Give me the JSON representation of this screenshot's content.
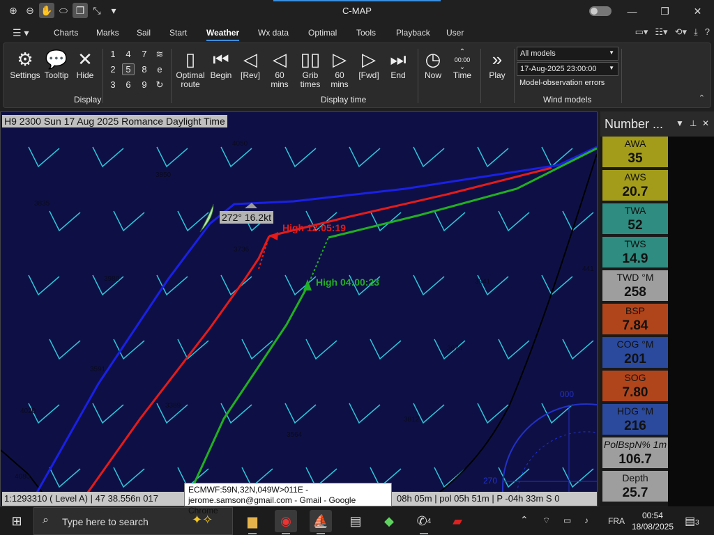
{
  "window": {
    "title": "C-MAP"
  },
  "menu": {
    "items": [
      "Charts",
      "Marks",
      "Sail",
      "Start",
      "Weather",
      "Wx data",
      "Optimal",
      "Tools",
      "Playback",
      "User"
    ],
    "active": "Weather"
  },
  "ribbon": {
    "display": {
      "settings": "Settings",
      "tooltip": "Tooltip",
      "hide": "Hide",
      "group": "Display",
      "numbers": [
        "1",
        "4",
        "7",
        "2",
        "5",
        "8",
        "3",
        "6",
        "9"
      ],
      "extra_e": "e"
    },
    "display_time": {
      "group": "Display time",
      "optimal_route": "Optimal route",
      "begin": "Begin",
      "rev": "[Rev]",
      "back60": "60 mins",
      "grib_times": "Grib times",
      "fwd60": "60 mins",
      "fwd": "[Fwd]",
      "end": "End",
      "now": "Now",
      "time": "Time",
      "time_clock": "00:00",
      "play": "Play"
    },
    "wind_models": {
      "group": "Wind models",
      "model": "All models",
      "datetime": "17-Aug-2025 23:00:00",
      "errors": "Model-observation errors"
    }
  },
  "map": {
    "header": "H9 2300 Sun 17 Aug 2025 Romance Daylight Time",
    "boat_label": "272° 16.2kt",
    "high_red": "High 12:05:19",
    "high_green": "High 04:00:23",
    "depths": [
      "4050",
      "3850",
      "3835",
      "3736",
      "3980",
      "3941",
      "3674",
      "3389",
      "3820",
      "4020",
      "3812",
      "3564",
      "4080",
      "441",
      "3591"
    ],
    "compass": [
      "000",
      "270"
    ],
    "status": "1:1293310 ( Level A) | 47 38.556n 017",
    "status_right": "08h 05m | pol 05h 51m | P -04h 33m S 0",
    "tooltip_line1": "ECMWF:59N,32N,049W>011E -",
    "tooltip_line2": "jerome.samson@gmail.com - Gmail - Google Chrome"
  },
  "panel": {
    "title": "Number ...",
    "cells": [
      {
        "label": "AWA",
        "value": "35",
        "color": "#a39c1a"
      },
      {
        "label": "AWS",
        "value": "20.7",
        "color": "#a39c1a"
      },
      {
        "label": "TWA",
        "value": "52",
        "color": "#2e8c80"
      },
      {
        "label": "TWS",
        "value": "14.9",
        "color": "#2e8c80"
      },
      {
        "label": "TWD °M",
        "value": "258",
        "color": "#9e9e9e"
      },
      {
        "label": "BSP",
        "value": "7.84",
        "color": "#b0451c"
      },
      {
        "label": "COG °M",
        "value": "201",
        "color": "#2b4a9e"
      },
      {
        "label": "SOG",
        "value": "7.80",
        "color": "#b0451c"
      },
      {
        "label": "HDG °M",
        "value": "216",
        "color": "#2b4a9e"
      },
      {
        "label": "PolBspN% 1m",
        "value": "106.7",
        "color": "#9e9e9e"
      },
      {
        "label": "Depth",
        "value": "25.7",
        "color": "#9e9e9e"
      }
    ]
  },
  "taskbar": {
    "search": "Type here to search",
    "lang": "FRA",
    "time": "00:54",
    "date": "18/08/2025",
    "notif_count": "3",
    "badge4": "4"
  }
}
